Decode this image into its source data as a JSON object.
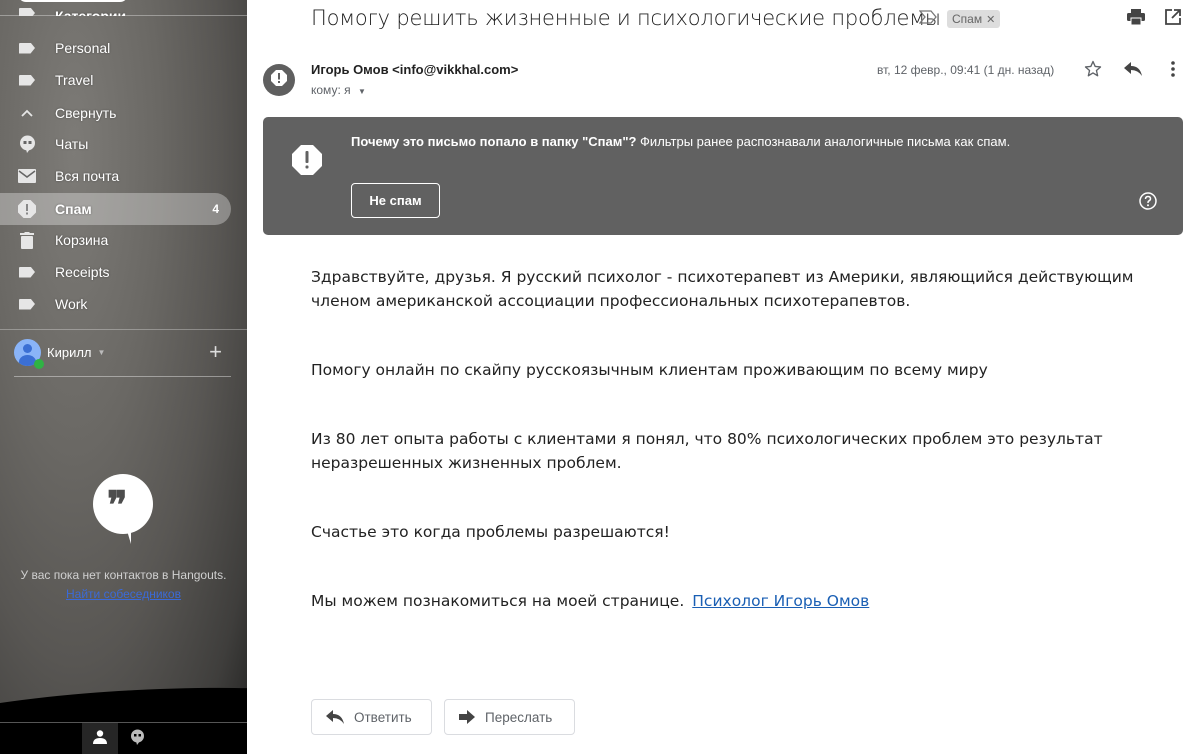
{
  "sidebar": {
    "partial_item": {
      "label": "Категории",
      "icon": "label-icon"
    },
    "items": [
      {
        "label": "Personal",
        "icon": "label-icon"
      },
      {
        "label": "Travel",
        "icon": "label-icon"
      },
      {
        "label": "Свернуть",
        "icon": "chevron-up-icon"
      },
      {
        "label": "Чаты",
        "icon": "chat-icon"
      },
      {
        "label": "Вся почта",
        "icon": "mail-icon"
      },
      {
        "label": "Спам",
        "icon": "spam-icon",
        "count": "4",
        "active": true
      },
      {
        "label": "Корзина",
        "icon": "trash-icon"
      },
      {
        "label": "Receipts",
        "icon": "label-icon"
      },
      {
        "label": "Work",
        "icon": "label-icon"
      }
    ],
    "user": {
      "name": "Кирилл",
      "status_color": "#2fb344"
    },
    "hangouts": {
      "empty_text": "У вас пока нет контактов в Hangouts.",
      "find_link": "Найти собеседников"
    }
  },
  "email": {
    "subject": "Помогу решить жизненные и психологические проблемы",
    "label_chip": "Спам",
    "sender": "Игорь Омов <info@vikkhal.com>",
    "to": "кому: я",
    "date": "вт, 12 февр., 09:41 (1 дн. назад)",
    "spam_banner": {
      "title": "Почему это письмо попало в папку \"Спам\"?",
      "text": " Фильтры ранее распознавали аналогичные письма как спам.",
      "not_spam_button": "Не спам"
    },
    "body": [
      "Здравствуйте, друзья. Я русский психолог - психотерапевт из Америки, являющийся действующим членом американской ассоциации профессиональных психотерапевтов.",
      "Помогу онлайн по скайпу русскоязычным клиентам проживающим по всему миру",
      "Из 80 лет опыта работы с клиентами я понял, что 80% психологических проблем это результат неразрешенных жизненных проблем.",
      "Счастье это когда проблемы разрешаются!",
      "Мы можем познакомиться на моей странице."
    ],
    "body_link": "Психолог Игорь Омов",
    "reply_button": "Ответить",
    "forward_button": "Переслать"
  },
  "colors": {
    "banner_bg": "#616161",
    "link": "#1a5fb4",
    "active_nav_bg": "rgba(255,255,255,0.32)"
  }
}
